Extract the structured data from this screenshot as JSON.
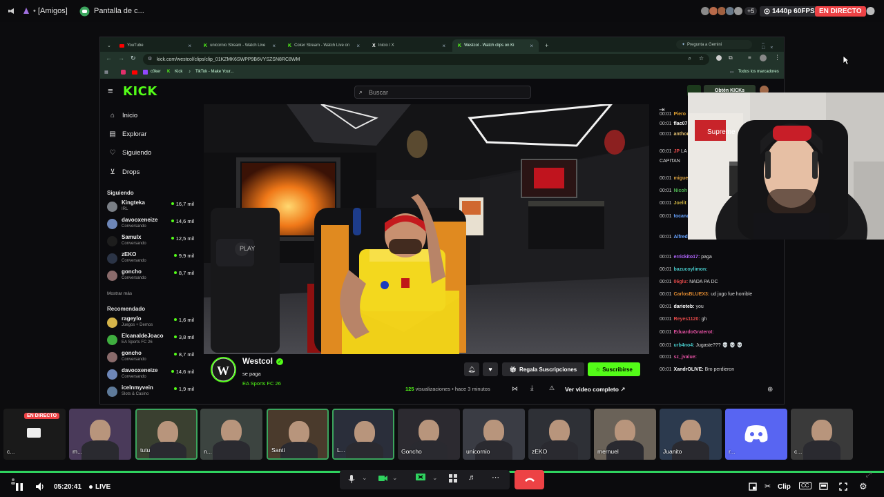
{
  "discord_top": {
    "server": "[Amigos]",
    "channel": "Pantalla de c...",
    "participant_extra": "+5",
    "quality": "1440p 60FPS",
    "live_badge": "EN DIRECTO"
  },
  "browser": {
    "tabs": [
      {
        "label": "YouTube"
      },
      {
        "label": "unicornio Stream - Watch Live"
      },
      {
        "label": "Coker Stream - Watch Live on"
      },
      {
        "label": "Inicio / X"
      },
      {
        "label": "Westcol - Watch clips on Ki"
      }
    ],
    "gemini_label": "Pregunta a Gemini",
    "url": "kick.com/westcol/clips/clip_01KZMK6SWPP9B6VYSZSN8RC8WM",
    "bookmarks": [
      "c0ker",
      "Kick",
      "TikTok - Make Your..."
    ],
    "all_bookmarks": "Todos los marcadores"
  },
  "kick": {
    "logo": "KICK",
    "search_placeholder": "Buscar",
    "get_kicks": "Obtén KICKs",
    "nav": [
      {
        "label": "Inicio",
        "icon": "home-icon"
      },
      {
        "label": "Explorar",
        "icon": "explore-icon"
      },
      {
        "label": "Siguiendo",
        "icon": "heart-icon"
      },
      {
        "label": "Drops",
        "icon": "drops-icon"
      }
    ],
    "following_title": "Siguiendo",
    "following": [
      {
        "name": "Kingteka",
        "game": "IRL",
        "viewers": "16,7 mil",
        "color": "#7a7f86"
      },
      {
        "name": "davooxeneize",
        "game": "Conversando",
        "viewers": "14,6 mil",
        "color": "#6d86b8"
      },
      {
        "name": "Samulx",
        "game": "Conversando",
        "viewers": "12,5 mil",
        "color": "#1d1d1d"
      },
      {
        "name": "zEKO",
        "game": "Conversando",
        "viewers": "9,9 mil",
        "color": "#2b3446"
      },
      {
        "name": "goncho",
        "game": "Conversando",
        "viewers": "8,7 mil",
        "color": "#8a6b6b"
      }
    ],
    "show_more": "Mostrar más",
    "recommended_title": "Recomendado",
    "recommended": [
      {
        "name": "rageylo",
        "game": "Juegos + Demos",
        "viewers": "1,6 mil",
        "color": "#d6b54a"
      },
      {
        "name": "ElcanaldeJoaco",
        "game": "EA Sports FC 26",
        "viewers": "3,8 mil",
        "color": "#3fae3f"
      },
      {
        "name": "goncho",
        "game": "Conversando",
        "viewers": "8,7 mil",
        "color": "#8a6b6b"
      },
      {
        "name": "davooxeneize",
        "game": "Conversando",
        "viewers": "14,6 mil",
        "color": "#6d86b8"
      },
      {
        "name": "icelnmyvein",
        "game": "Slots & Casino",
        "viewers": "1,9 mil",
        "color": "#5e7a9a"
      }
    ],
    "channel": {
      "name": "Westcol",
      "clip_title": "se paga",
      "game": "EA Sports FC 26",
      "views_count": "125",
      "views_label": "visualizaciones",
      "time_ago": "hace 3 minutos",
      "gift_subs": "Regala Suscripciones",
      "subscribe": "Suscribirse",
      "watch_full": "Ver video completo"
    },
    "chat": [
      {
        "time": "00:01",
        "user": "Piero",
        "text": "",
        "color": "#e0a030"
      },
      {
        "time": "00:01",
        "user": "flac07",
        "text": "",
        "color": "#ffffff"
      },
      {
        "time": "00:01",
        "user": "anthon",
        "text": "",
        "color": "#e3c070"
      },
      {
        "time": "00:01",
        "user": "JP",
        "text": "LA PEDIASS",
        "color": "#e04848"
      },
      {
        "time": "",
        "user": "",
        "text": "CAPITAN",
        "color": "#ddd"
      },
      {
        "time": "00:01",
        "user": "miguel",
        "text": "",
        "color": "#d8a040"
      },
      {
        "time": "00:01",
        "user": "Nicoh",
        "text": "",
        "color": "#4caf50"
      },
      {
        "time": "00:01",
        "user": "Joelit",
        "text": "",
        "color": "#c9b040"
      },
      {
        "time": "00:01",
        "user": "tocanaig:",
        "text": "",
        "color": "#66a3ff"
      },
      {
        "time": "00:01",
        "user": "Alfredo_7778:",
        "text": "",
        "color": "#66a3ff"
      },
      {
        "time": "00:01",
        "user": "errickito17:",
        "text": "paga",
        "color": "#b266ff"
      },
      {
        "time": "00:01",
        "user": "bazucoylimon:",
        "text": "",
        "color": "#46c6c6"
      },
      {
        "time": "00:01",
        "user": "06glu:",
        "text": "NADA PA DC",
        "color": "#e04848"
      },
      {
        "time": "00:01",
        "user": "CarlosBLUEX3:",
        "text": "ud jugo fue horrible",
        "color": "#e08a30"
      },
      {
        "time": "00:01",
        "user": "darioteb:",
        "text": "you",
        "color": "#ffffff"
      },
      {
        "time": "00:01",
        "user": "Reyes1120:",
        "text": "gh",
        "color": "#e04848"
      },
      {
        "time": "00:01",
        "user": "EduardoGrateroI:",
        "text": "",
        "color": "#e050a0"
      },
      {
        "time": "00:01",
        "user": "urb4no4:",
        "text": "Jugaste??? 💀 💀 💀",
        "color": "#46c6c6"
      },
      {
        "time": "00:01",
        "user": "sz_jvalue:",
        "text": "",
        "color": "#e050a0"
      },
      {
        "time": "00:01",
        "user": "XandrOLIVE:",
        "text": "Bro perdieron",
        "color": "#ffffff"
      }
    ]
  },
  "participants": [
    {
      "label": "c...",
      "live": "EN DIRECTO",
      "color": "#1a1a1a"
    },
    {
      "label": "m...",
      "color": "#4a3a5a"
    },
    {
      "label": "tutu",
      "color": "#3a4030"
    },
    {
      "label": "n...",
      "color": "#3c4440"
    },
    {
      "label": "Santi",
      "color": "#4a3a2c"
    },
    {
      "label": "L...",
      "color": "#2a2e3a"
    },
    {
      "label": "Goncho",
      "color": "#2c2a30"
    },
    {
      "label": "unicornio",
      "color": "#3a3c44"
    },
    {
      "label": "zEKO",
      "color": "#2e3036"
    },
    {
      "label": "mernuel",
      "color": "#6a6258"
    },
    {
      "label": "Juanito",
      "color": "#2c3a4e"
    },
    {
      "label": "r...",
      "color": "#5865f2"
    },
    {
      "label": "c...",
      "color": "#3a3a3a"
    }
  ],
  "bottom": {
    "time": "05:20:41",
    "live": "LIVE",
    "clip": "Clip"
  }
}
